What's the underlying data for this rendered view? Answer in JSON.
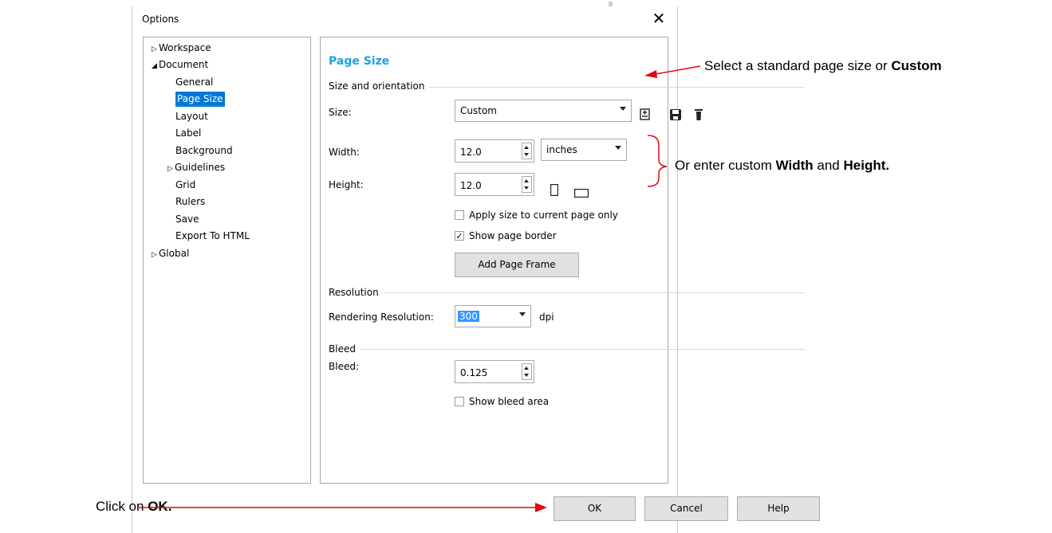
{
  "window": {
    "title": "Options",
    "close_glyph": "✕"
  },
  "tree": {
    "workspace": "Workspace",
    "document": "Document",
    "children": [
      "General",
      "Page Size",
      "Layout",
      "Label",
      "Background",
      "Guidelines",
      "Grid",
      "Rulers",
      "Save",
      "Export To HTML"
    ],
    "global": "Global",
    "selected": "Page Size"
  },
  "panel": {
    "title": "Page Size",
    "size_group": "Size and orientation",
    "size_label": "Size:",
    "size_value": "Custom",
    "width_label": "Width:",
    "width_value": "12.0",
    "units_value": "inches",
    "height_label": "Height:",
    "height_value": "12.0",
    "apply_current_label": "Apply size to current page only",
    "apply_current_checked": false,
    "show_border_label": "Show page border",
    "show_border_checked": true,
    "add_frame_label": "Add Page Frame",
    "resolution_group": "Resolution",
    "rendering_label": "Rendering Resolution:",
    "rendering_value": "300",
    "dpi_label": "dpi",
    "bleed_group": "Bleed",
    "bleed_label": "Bleed:",
    "bleed_value": "0.125",
    "show_bleed_label": "Show bleed area",
    "show_bleed_checked": false
  },
  "footer": {
    "ok": "OK",
    "cancel": "Cancel",
    "help": "Help"
  },
  "annotations": {
    "size_text": "Select a standard page size or ",
    "size_bold": "Custom",
    "dims_text_1": "Or enter custom ",
    "dims_bold_1": "Width",
    "dims_text_2": " and ",
    "dims_bold_2": "Height.",
    "ok_text": "Click on ",
    "ok_bold": "OK.",
    "arrow_color": "#e30613"
  },
  "icons": [
    "expand-triangle-icon",
    "collapse-triangle-icon",
    "add-preset-icon",
    "save-preset-icon",
    "delete-preset-icon",
    "portrait-icon",
    "landscape-icon",
    "checkmark-icon"
  ]
}
